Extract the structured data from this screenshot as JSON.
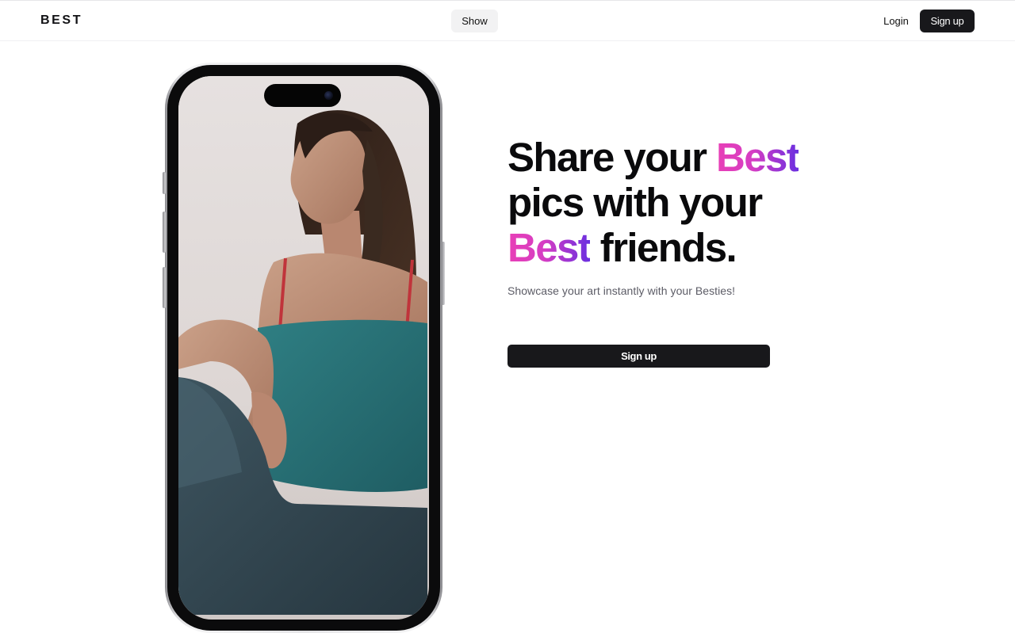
{
  "header": {
    "logo": "BEST",
    "nav_center_label": "Show",
    "login_label": "Login",
    "signup_label": "Sign up"
  },
  "hero": {
    "headline": {
      "line1_prefix": "Share your ",
      "line1_highlight": "Best",
      "line2": "pics with your",
      "line3_highlight": "Best",
      "line3_suffix": " friends."
    },
    "subtitle": "Showcase your art instantly with your Besties!",
    "cta_label": "Sign up"
  },
  "phone": {
    "image_subject": "woman-seated-portrait",
    "frame_color": "#0b0b0c"
  },
  "colors": {
    "accent_gradient_start": "#e83fb6",
    "accent_gradient_end": "#6a2fe0",
    "primary_button": "#18181b",
    "secondary_button": "#f2f2f3"
  }
}
